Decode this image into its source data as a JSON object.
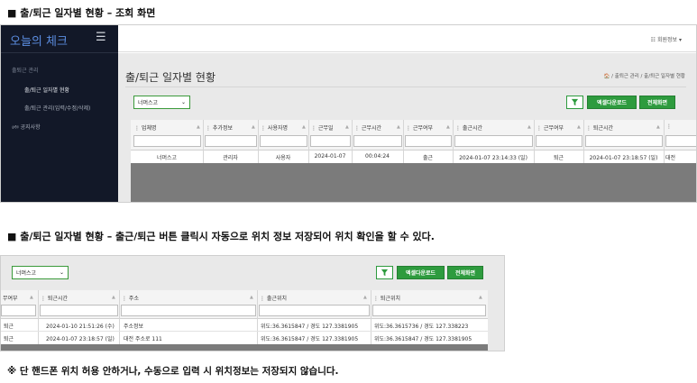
{
  "captions": {
    "heading1": "■ 출/퇴근 일자별 현황 – 조회 화면",
    "heading2": "■ 출/퇴근 일자별 현황 – 출근/퇴근 버튼 클릭시 자동으로 위치 정보 저장되어 위치 확인을 할 수 있다.",
    "note": "※ 단 핸드폰 위치 허용 안하거나, 수동으로 입력 시 위치정보는 저장되지 않습니다."
  },
  "sidebar": {
    "brand": "오늘의 체크",
    "group": "출퇴근 관리",
    "items": [
      "출/퇴근 일자별 현황",
      "출/퇴근 관리(입력/수정/삭제)"
    ],
    "notice": "공지사항"
  },
  "topbar": {
    "member": "회원정보"
  },
  "page": {
    "title": "출/퇴근 일자별 현황",
    "breadcrumb": "/ 출퇴근 관리 / 출/퇴근 일자별 현황"
  },
  "toolbar": {
    "select_value": "너머스고",
    "excel_label": "엑셀다운로드",
    "full_label": "전체화면"
  },
  "grid1": {
    "headers": [
      "업체명",
      "추가정보",
      "사용자명",
      "근무일",
      "근무시간",
      "근무여부",
      "출근시간",
      "근무여부",
      "퇴근시간"
    ],
    "row": [
      "너머스고",
      "관리자",
      "사용자",
      "2024-01-07",
      "00:04:24",
      "출근",
      "2024-01-07 23:14:33 (일)",
      "퇴근",
      "2024-01-07 23:18:57 (일)",
      "대전"
    ]
  },
  "grid2": {
    "headers": [
      "무여부",
      "퇴근시간",
      "주소",
      "출근위치",
      "퇴근위치"
    ],
    "rows": [
      [
        "퇴근",
        "2024-01-10 21:51:26 (수)",
        "주소정보",
        "위도:36.3615847 / 경도 127.3381905",
        "위도:36.3615736 / 경도 127.338223"
      ],
      [
        "퇴근",
        "2024-01-07 23:18:57 (일)",
        "대전 주소로 111",
        "위도:36.3615847 / 경도 127.3381905",
        "위도:36.3615847 / 경도 127.3381905"
      ]
    ]
  }
}
